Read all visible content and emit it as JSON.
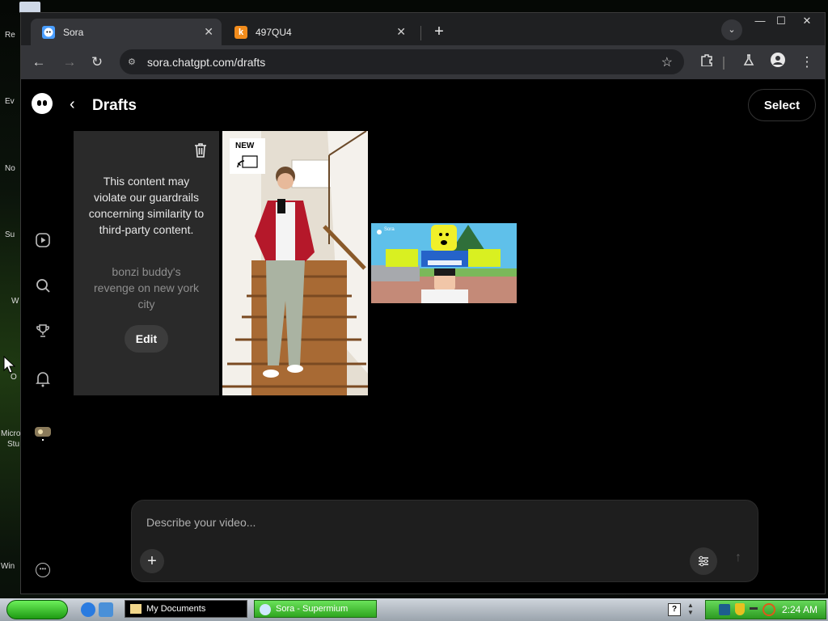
{
  "desktop": {
    "icon_labels": [
      "Re",
      "Ev",
      "No",
      "Su",
      "W",
      "O",
      "Micro",
      "Stu",
      "Win"
    ]
  },
  "browser": {
    "tabs": [
      {
        "title": "Sora",
        "active": true,
        "favicon": "sora-ghost-icon"
      },
      {
        "title": "497QU4",
        "active": false,
        "favicon": "k-icon",
        "favicon_letter": "k"
      }
    ],
    "url": "sora.chatgpt.com/drafts"
  },
  "page": {
    "title": "Drafts",
    "select_label": "Select",
    "drafts": [
      {
        "type": "blocked",
        "message": "This content may violate our guardrails concerning similarity to third-party content.",
        "prompt": "bonzi buddy's revenge on new york city",
        "edit_label": "Edit"
      },
      {
        "type": "video",
        "badge": "NEW",
        "subject": "stairs"
      },
      {
        "type": "video",
        "subject": "roblox",
        "watermark": "Sora"
      }
    ],
    "composer": {
      "placeholder": "Describe your video..."
    }
  },
  "taskbar": {
    "tasks": [
      "My Documents",
      "Sora - Supermium"
    ],
    "clock": "2:24 AM"
  },
  "colors": {
    "accent_green": "#2ea51f",
    "page_bg": "#000000",
    "card_bg": "#2a2a2a"
  }
}
